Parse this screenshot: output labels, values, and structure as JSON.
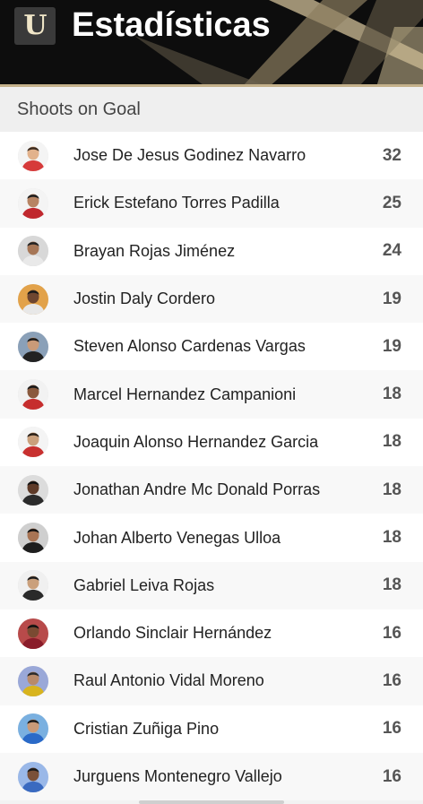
{
  "header": {
    "title": "Estadísticas",
    "logo_letter": "U"
  },
  "section": {
    "title": "Shoots on Goal"
  },
  "colors": {
    "header_bg": "#0d0d0d",
    "accent_gold": "#c4b18b",
    "value_text": "#555555"
  },
  "players": [
    {
      "name": "Jose De Jesus Godinez Navarro",
      "value": "32",
      "shirt": "#d63a3a",
      "skin": "#e2b28c",
      "hair": "#3a2a1e",
      "bg": "#f4f4f4"
    },
    {
      "name": "Erick Estefano Torres Padilla",
      "value": "25",
      "shirt": "#c0282e",
      "skin": "#b78463",
      "hair": "#1e1e1e",
      "bg": "#f4f4f4"
    },
    {
      "name": "Brayan Rojas Jiménez",
      "value": "24",
      "shirt": "#e9e9e9",
      "skin": "#a67656",
      "hair": "#222222",
      "bg": "#d8d8d8"
    },
    {
      "name": "Jostin Daly Cordero",
      "value": "19",
      "shirt": "#e8e8e8",
      "skin": "#6e4630",
      "hair": "#1a1a1a",
      "bg": "#e2a24a"
    },
    {
      "name": "Steven Alonso Cardenas Vargas",
      "value": "19",
      "shirt": "#222222",
      "skin": "#c99a78",
      "hair": "#1a1a1a",
      "bg": "#8aa0b8"
    },
    {
      "name": "Marcel Hernandez Campanioni",
      "value": "18",
      "shirt": "#c62e2e",
      "skin": "#8a5a3e",
      "hair": "#1a1a1a",
      "bg": "#f2f2f2"
    },
    {
      "name": "Joaquin Alonso Hernandez Garcia",
      "value": "18",
      "shirt": "#c8302f",
      "skin": "#caa07c",
      "hair": "#2a1f16",
      "bg": "#f4f4f4"
    },
    {
      "name": "Jonathan Andre Mc Donald Porras",
      "value": "18",
      "shirt": "#2b2b2b",
      "skin": "#5e3a28",
      "hair": "#111111",
      "bg": "#dcdcdc"
    },
    {
      "name": "Johan Alberto Venegas Ulloa",
      "value": "18",
      "shirt": "#1e1e1e",
      "skin": "#a87454",
      "hair": "#111111",
      "bg": "#cfcfcf"
    },
    {
      "name": "Gabriel Leiva Rojas",
      "value": "18",
      "shirt": "#2a2a2a",
      "skin": "#caa07c",
      "hair": "#1a1a1a",
      "bg": "#f0f0f0"
    },
    {
      "name": "Orlando Sinclair Hernández",
      "value": "16",
      "shirt": "#8a1c2a",
      "skin": "#7a4a32",
      "hair": "#111111",
      "bg": "#b84a4a"
    },
    {
      "name": "Raul Antonio Vidal Moreno",
      "value": "16",
      "shirt": "#d8b41e",
      "skin": "#b88a6a",
      "hair": "#2a2a2a",
      "bg": "#9aa8d8"
    },
    {
      "name": "Cristian Zuñiga Pino",
      "value": "16",
      "shirt": "#2a6ac8",
      "skin": "#c99a78",
      "hair": "#1a1a1a",
      "bg": "#7ab0e0"
    },
    {
      "name": "Jurguens Montenegro Vallejo",
      "value": "16",
      "shirt": "#3a6ac0",
      "skin": "#7a5038",
      "hair": "#1a1a1a",
      "bg": "#9ab8e8"
    }
  ]
}
